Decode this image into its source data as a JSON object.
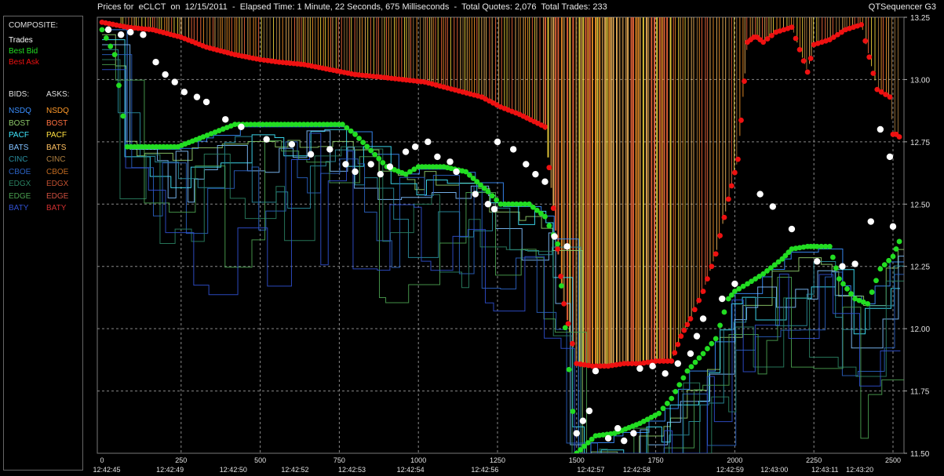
{
  "header": {
    "title": "Prices for  eCLCT  on  12/15/2011  -  Elapsed Time: 1 Minute, 22 Seconds, 675 Milliseconds  -  Total Quotes: 2,076  Total Trades: 233",
    "app_name": "QTSequencer G3"
  },
  "legend": {
    "composite_heading": "COMPOSITE:",
    "composite": [
      {
        "label": "Trades",
        "color": "#ffffff"
      },
      {
        "label": "Best Bid",
        "color": "#22dd22"
      },
      {
        "label": "Best Ask",
        "color": "#ee1111"
      }
    ],
    "bids_heading": "BIDS:",
    "asks_heading": "ASKS:",
    "exchanges": [
      {
        "bid": "NSDQ",
        "ask": "NSDQ",
        "bid_color": "#3a8fff",
        "ask_color": "#ff9a2a"
      },
      {
        "bid": "BOST",
        "ask": "BOST",
        "bid_color": "#8fcc6a",
        "ask_color": "#ff7040"
      },
      {
        "bid": "PACF",
        "ask": "PACF",
        "bid_color": "#40e8ff",
        "ask_color": "#ffe040"
      },
      {
        "bid": "BATS",
        "ask": "BATS",
        "bid_color": "#80c0ff",
        "ask_color": "#ffc060"
      },
      {
        "bid": "CINC",
        "ask": "CINC",
        "bid_color": "#2a8fa0",
        "ask_color": "#b08040"
      },
      {
        "bid": "CBOE",
        "ask": "CBOE",
        "bid_color": "#2a60c0",
        "ask_color": "#c06a20"
      },
      {
        "bid": "EDGX",
        "ask": "EDGX",
        "bid_color": "#2a8060",
        "ask_color": "#c05030"
      },
      {
        "bid": "EDGE",
        "ask": "EDGE",
        "bid_color": "#4aa050",
        "ask_color": "#d05040"
      },
      {
        "bid": "BATY",
        "ask": "BATY",
        "bid_color": "#3050d0",
        "ask_color": "#d03030"
      }
    ]
  },
  "chart_data": {
    "type": "line",
    "grid": true,
    "ylim": [
      11.5,
      13.25
    ],
    "xlim": [
      0,
      2520
    ],
    "y_ticks": [
      "13.25",
      "13.00",
      "12.75",
      "12.50",
      "12.25",
      "12.00",
      "11.75",
      "11.50"
    ],
    "y_tick_values": [
      13.25,
      13.0,
      12.75,
      12.5,
      12.25,
      12.0,
      11.75,
      11.5
    ],
    "x_ticks": [
      "0",
      "250",
      "500",
      "750",
      "1000",
      "1250",
      "1500",
      "1750",
      "2000",
      "2250",
      "2500"
    ],
    "x_tick_values": [
      0,
      250,
      500,
      750,
      1000,
      1250,
      1500,
      1750,
      2000,
      2250,
      2500
    ],
    "time_labels": [
      {
        "x": 0,
        "label": "12:42:45"
      },
      {
        "x": 215,
        "label": "12:42:49"
      },
      {
        "x": 415,
        "label": "12:42:50"
      },
      {
        "x": 610,
        "label": "12:42:52"
      },
      {
        "x": 790,
        "label": "12:42:53"
      },
      {
        "x": 975,
        "label": "12:42:54"
      },
      {
        "x": 1210,
        "label": "12:42:56"
      },
      {
        "x": 1545,
        "label": "12:42:57"
      },
      {
        "x": 1690,
        "label": "12:42:58"
      },
      {
        "x": 1985,
        "label": "12:42:59"
      },
      {
        "x": 2125,
        "label": "12:43:00"
      },
      {
        "x": 2285,
        "label": "12:43:11"
      },
      {
        "x": 2395,
        "label": "12:43:20"
      }
    ],
    "series": [
      {
        "name": "Best Ask",
        "color": "#ee1111",
        "x": [
          0,
          80,
          160,
          250,
          330,
          420,
          500,
          560,
          640,
          720,
          800,
          880,
          950,
          1020,
          1080,
          1140,
          1200,
          1260,
          1320,
          1400,
          1440,
          1460,
          1500,
          1550,
          1600,
          1650,
          1700,
          1750,
          1800,
          1830,
          1860,
          1900,
          1940,
          1980,
          2010,
          2040,
          2060,
          2070,
          2090,
          2130,
          2180,
          2230,
          2250,
          2300,
          2350,
          2400,
          2450,
          2490,
          2500,
          2510,
          2520
        ],
        "y": [
          13.23,
          13.21,
          13.2,
          13.17,
          13.13,
          13.1,
          13.08,
          13.07,
          13.06,
          13.04,
          13.02,
          13.01,
          13.0,
          12.99,
          12.97,
          12.95,
          12.93,
          12.89,
          12.86,
          12.81,
          12.32,
          12.1,
          11.86,
          11.85,
          11.85,
          11.86,
          11.86,
          11.87,
          11.87,
          11.97,
          12.04,
          12.15,
          12.3,
          12.52,
          12.68,
          13.15,
          13.17,
          13.17,
          13.15,
          13.19,
          13.21,
          13.03,
          13.14,
          13.16,
          13.2,
          13.22,
          12.96,
          12.93,
          12.78,
          12.78,
          12.77
        ]
      },
      {
        "name": "Best Bid",
        "color": "#22dd22",
        "x": [
          0,
          40,
          80,
          160,
          240,
          320,
          420,
          520,
          600,
          700,
          760,
          800,
          900,
          960,
          1000,
          1080,
          1150,
          1220,
          1260,
          1310,
          1350,
          1400,
          1440,
          1500,
          1560,
          1620,
          1700,
          1760,
          1800,
          1850,
          1900,
          1940,
          1980,
          2000,
          2040,
          2090,
          2150,
          2180,
          2230,
          2260,
          2300,
          2330,
          2380,
          2420,
          2460,
          2500,
          2520
        ],
        "y": [
          13.2,
          13.1,
          12.73,
          12.73,
          12.73,
          12.77,
          12.82,
          12.82,
          12.82,
          12.82,
          12.82,
          12.78,
          12.65,
          12.62,
          12.65,
          12.65,
          12.63,
          12.55,
          12.5,
          12.5,
          12.5,
          12.45,
          12.34,
          11.5,
          11.57,
          11.58,
          11.62,
          11.66,
          11.72,
          11.83,
          11.9,
          11.96,
          12.12,
          12.15,
          12.18,
          12.22,
          12.28,
          12.32,
          12.33,
          12.33,
          12.33,
          12.2,
          12.12,
          12.1,
          12.24,
          12.29,
          12.35
        ]
      },
      {
        "name": "Trades",
        "color": "#ffffff",
        "x": [
          20,
          60,
          90,
          130,
          170,
          200,
          230,
          260,
          300,
          330,
          390,
          440,
          520,
          600,
          660,
          720,
          770,
          800,
          850,
          880,
          910,
          960,
          990,
          1030,
          1060,
          1100,
          1120,
          1180,
          1220,
          1240,
          1250,
          1300,
          1340,
          1370,
          1400,
          1430,
          1470,
          1500,
          1520,
          1540,
          1560,
          1600,
          1630,
          1650,
          1680,
          1700,
          1740,
          1780,
          1820,
          1860,
          1880,
          1900,
          1960,
          2000,
          2080,
          2120,
          2180,
          2260,
          2340,
          2380,
          2430,
          2460,
          2490,
          2500
        ],
        "y": [
          13.2,
          13.18,
          13.19,
          13.18,
          13.07,
          13.02,
          12.99,
          12.95,
          12.93,
          12.91,
          12.84,
          12.81,
          12.76,
          12.74,
          12.7,
          12.72,
          12.66,
          12.63,
          12.66,
          12.62,
          12.65,
          12.71,
          12.73,
          12.75,
          12.69,
          12.67,
          12.63,
          12.54,
          12.5,
          12.48,
          12.75,
          12.72,
          12.66,
          12.62,
          12.59,
          12.37,
          12.33,
          11.58,
          11.63,
          11.67,
          11.83,
          11.56,
          11.6,
          11.55,
          11.58,
          11.84,
          11.85,
          11.82,
          11.86,
          11.9,
          11.97,
          12.04,
          12.12,
          12.18,
          12.54,
          12.49,
          12.4,
          12.27,
          12.25,
          12.26,
          12.43,
          12.8,
          12.69,
          12.41
        ]
      }
    ]
  }
}
